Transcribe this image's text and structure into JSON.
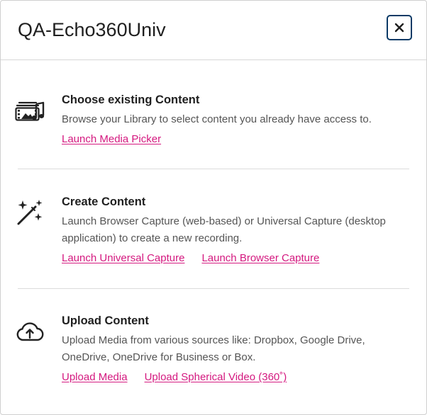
{
  "dialog": {
    "title": "QA-Echo360Univ",
    "close_label": "×"
  },
  "sections": [
    {
      "icon": "media-library-icon",
      "heading": "Choose existing Content",
      "description": "Browse your Library to select content you already have access to.",
      "links": [
        "Launch Media Picker"
      ]
    },
    {
      "icon": "magic-wand-icon",
      "heading": "Create Content",
      "description": "Launch Browser Capture (web-based) or Universal Capture (desktop application) to create a new recording.",
      "links": [
        "Launch Universal Capture",
        "Launch Browser Capture"
      ]
    },
    {
      "icon": "cloud-upload-icon",
      "heading": "Upload Content",
      "description": "Upload Media from various sources like: Dropbox, Google Drive, OneDrive, OneDrive for Business or Box.",
      "links": [
        "Upload Media",
        "Upload Spherical Video (360˚)"
      ]
    }
  ],
  "colors": {
    "link": "#d4187f",
    "close_border": "#0b3a66",
    "heading": "#1f1f1f",
    "body_text": "#555555",
    "divider": "#dcdcdc"
  }
}
